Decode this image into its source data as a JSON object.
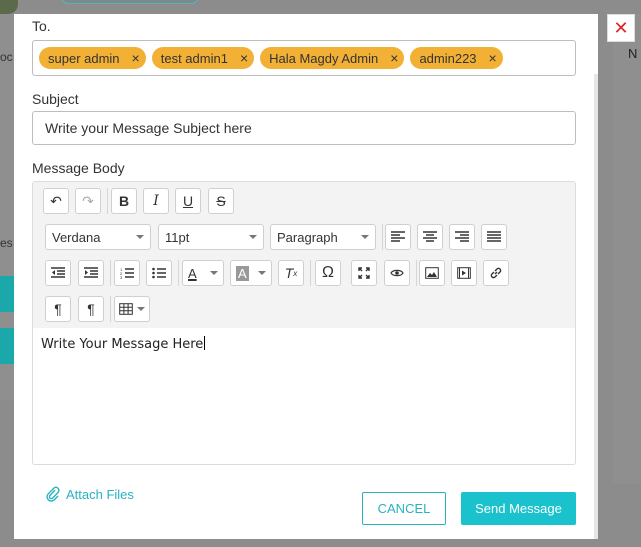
{
  "background": {
    "text_left_top": "oc",
    "text_left_mid": "es",
    "text_right": "N"
  },
  "modal": {
    "to_label": "To.",
    "recipients": [
      {
        "name": "super admin"
      },
      {
        "name": "test admin1"
      },
      {
        "name": "Hala Magdy Admin"
      },
      {
        "name": "admin223"
      }
    ],
    "remove_glyph": "×",
    "subject_label": "Subject",
    "subject_value": "Write your Message Subject here",
    "body_label": "Message Body",
    "toolbar": {
      "font_family": "Verdana",
      "font_size": "11pt",
      "block_format": "Paragraph"
    },
    "body_text": "Write Your Message Here",
    "attach_label": "Attach Files",
    "cancel_label": "CANCEL",
    "send_label": "Send Message"
  },
  "colors": {
    "chip": "#f2b134",
    "accent": "#28b3c0",
    "send": "#19c2cc",
    "close": "#e02424"
  }
}
